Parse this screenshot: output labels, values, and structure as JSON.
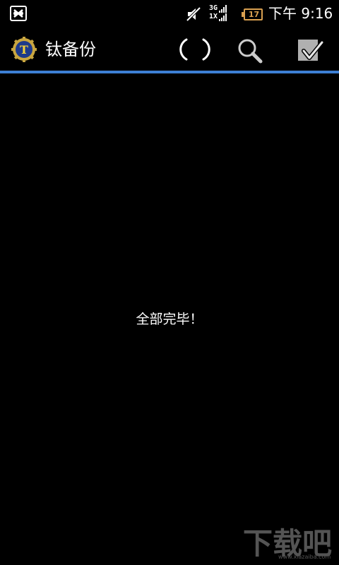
{
  "status_bar": {
    "network_top": "3G",
    "network_bottom": "1X",
    "battery_level": "17",
    "time": "下午 9:16",
    "icons": [
      "notification-app-icon",
      "mute-icon",
      "signal-icon",
      "battery-icon"
    ],
    "battery_color": "#d9a050"
  },
  "action_bar": {
    "title": "钛备份",
    "icons": [
      "titanium-backup-logo",
      "loading-spinner",
      "search-icon",
      "select-all-icon"
    ],
    "accent_color": "#3d7fd4"
  },
  "main": {
    "message": "全部完毕！"
  },
  "watermark": {
    "logo": "下载吧",
    "url": "www.xiazaiba.com"
  }
}
